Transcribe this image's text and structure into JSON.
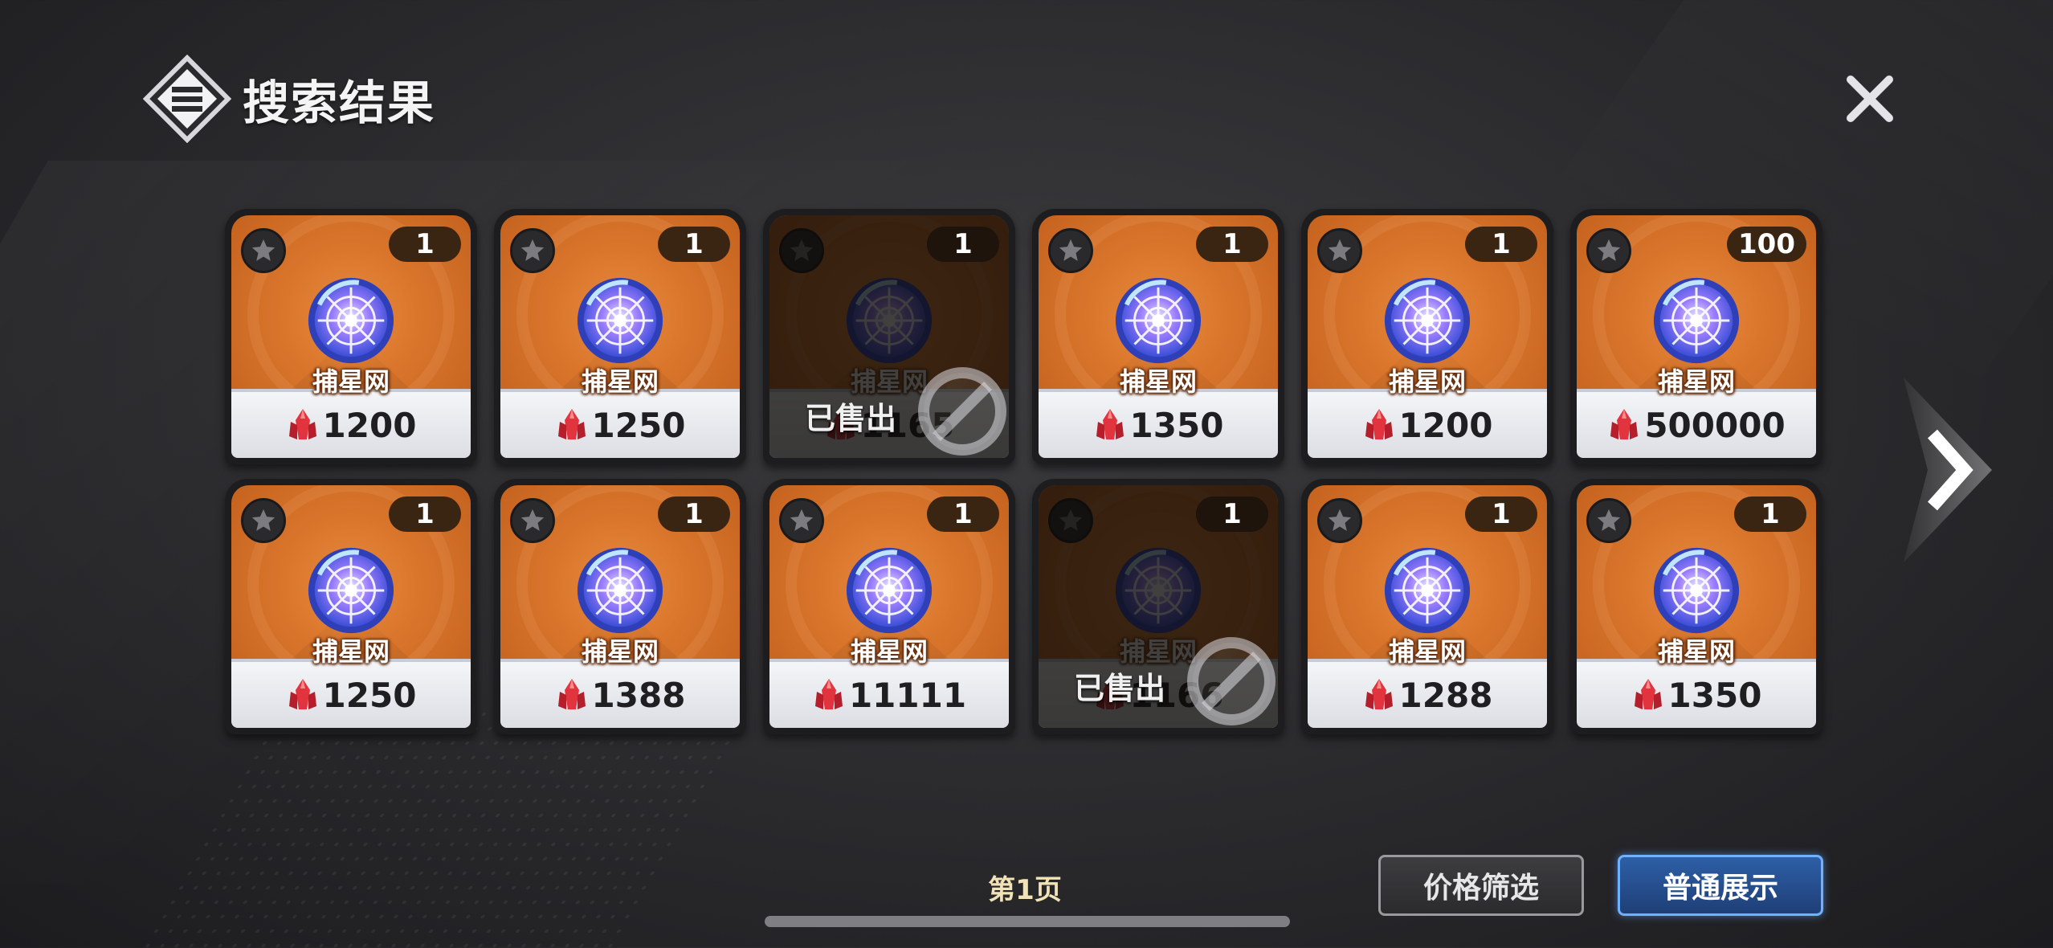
{
  "header": {
    "title": "搜索结果"
  },
  "icons": {
    "logo": "menu-diamond-icon",
    "close": "close-icon",
    "star": "star-icon",
    "item": "star-net-icon",
    "currency": "crystal-icon",
    "sold": "ban-icon",
    "next": "chevron-right-icon"
  },
  "items": [
    {
      "qty": "1",
      "name": "捕星网",
      "price": "1200",
      "sold": false
    },
    {
      "qty": "1",
      "name": "捕星网",
      "price": "1250",
      "sold": false
    },
    {
      "qty": "1",
      "name": "捕星网",
      "price": "1165",
      "sold": true
    },
    {
      "qty": "1",
      "name": "捕星网",
      "price": "1350",
      "sold": false
    },
    {
      "qty": "1",
      "name": "捕星网",
      "price": "1200",
      "sold": false
    },
    {
      "qty": "100",
      "name": "捕星网",
      "price": "500000",
      "sold": false
    },
    {
      "qty": "1",
      "name": "捕星网",
      "price": "1250",
      "sold": false
    },
    {
      "qty": "1",
      "name": "捕星网",
      "price": "1388",
      "sold": false
    },
    {
      "qty": "1",
      "name": "捕星网",
      "price": "11111",
      "sold": false
    },
    {
      "qty": "1",
      "name": "捕星网",
      "price": "1166",
      "sold": true
    },
    {
      "qty": "1",
      "name": "捕星网",
      "price": "1288",
      "sold": false
    },
    {
      "qty": "1",
      "name": "捕星网",
      "price": "1350",
      "sold": false
    }
  ],
  "sold_label": "已售出",
  "pagination": {
    "page_label": "第1页"
  },
  "buttons": {
    "price_filter": "价格筛选",
    "normal_display": "普通展示"
  },
  "colors": {
    "card_orange": "#d9752b",
    "button_blue": "#2d5fa6",
    "page_label": "#f1e2b8"
  }
}
